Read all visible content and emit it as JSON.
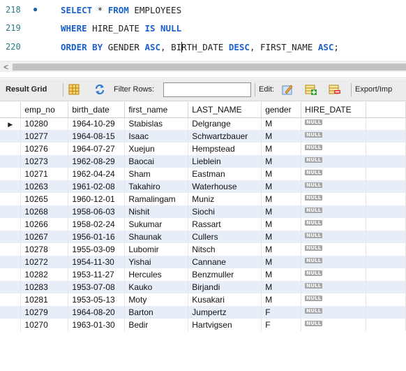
{
  "editor": {
    "lines": [
      {
        "num": "218",
        "marker": "●",
        "tokens": [
          {
            "t": "SELECT",
            "k": true
          },
          {
            "t": " * ",
            "k": false
          },
          {
            "t": "FROM",
            "k": true
          },
          {
            "t": " EMPLOYEES",
            "k": false
          }
        ]
      },
      {
        "num": "219",
        "marker": "",
        "tokens": [
          {
            "t": "WHERE",
            "k": true
          },
          {
            "t": " HIRE_DATE ",
            "k": false
          },
          {
            "t": "IS NULL",
            "k": true
          }
        ]
      },
      {
        "num": "220",
        "marker": "",
        "tokens": [
          {
            "t": "ORDER BY",
            "k": true
          },
          {
            "t": " GENDER ",
            "k": false
          },
          {
            "t": "ASC",
            "k": true
          },
          {
            "t": ", BI",
            "k": false
          },
          {
            "t": "|",
            "k": false
          },
          {
            "t": "RTH_DATE ",
            "k": false
          },
          {
            "t": "DESC",
            "k": true
          },
          {
            "t": ", FIRST_NAME ",
            "k": false
          },
          {
            "t": "ASC",
            "k": true
          },
          {
            "t": ";",
            "k": false
          }
        ]
      }
    ]
  },
  "scrollbar": {
    "left_arrow": "<"
  },
  "toolbar": {
    "result_grid": "Result Grid",
    "filter_rows": "Filter Rows:",
    "filter_value": "",
    "edit": "Edit:",
    "export": "Export/Imp"
  },
  "grid": {
    "columns": [
      "emp_no",
      "birth_date",
      "first_name",
      "LAST_NAME",
      "gender",
      "HIRE_DATE"
    ],
    "null_label": "NULL",
    "current_row_marker": "▶",
    "rows": [
      [
        "10280",
        "1964-10-29",
        "Stabislas",
        "Delgrange",
        "M"
      ],
      [
        "10277",
        "1964-08-15",
        "Isaac",
        "Schwartzbauer",
        "M"
      ],
      [
        "10276",
        "1964-07-27",
        "Xuejun",
        "Hempstead",
        "M"
      ],
      [
        "10273",
        "1962-08-29",
        "Baocai",
        "Lieblein",
        "M"
      ],
      [
        "10271",
        "1962-04-24",
        "Sham",
        "Eastman",
        "M"
      ],
      [
        "10263",
        "1961-02-08",
        "Takahiro",
        "Waterhouse",
        "M"
      ],
      [
        "10265",
        "1960-12-01",
        "Ramalingam",
        "Muniz",
        "M"
      ],
      [
        "10268",
        "1958-06-03",
        "Nishit",
        "Siochi",
        "M"
      ],
      [
        "10266",
        "1958-02-24",
        "Sukumar",
        "Rassart",
        "M"
      ],
      [
        "10267",
        "1956-01-16",
        "Shaunak",
        "Cullers",
        "M"
      ],
      [
        "10278",
        "1955-03-09",
        "Lubomir",
        "Nitsch",
        "M"
      ],
      [
        "10272",
        "1954-11-30",
        "Yishai",
        "Cannane",
        "M"
      ],
      [
        "10282",
        "1953-11-27",
        "Hercules",
        "Benzmuller",
        "M"
      ],
      [
        "10283",
        "1953-07-08",
        "Kauko",
        "Birjandi",
        "M"
      ],
      [
        "10281",
        "1953-05-13",
        "Moty",
        "Kusakari",
        "M"
      ],
      [
        "10279",
        "1964-08-20",
        "Barton",
        "Jumpertz",
        "F"
      ],
      [
        "10270",
        "1963-01-30",
        "Bedir",
        "Hartvigsen",
        "F"
      ]
    ]
  }
}
